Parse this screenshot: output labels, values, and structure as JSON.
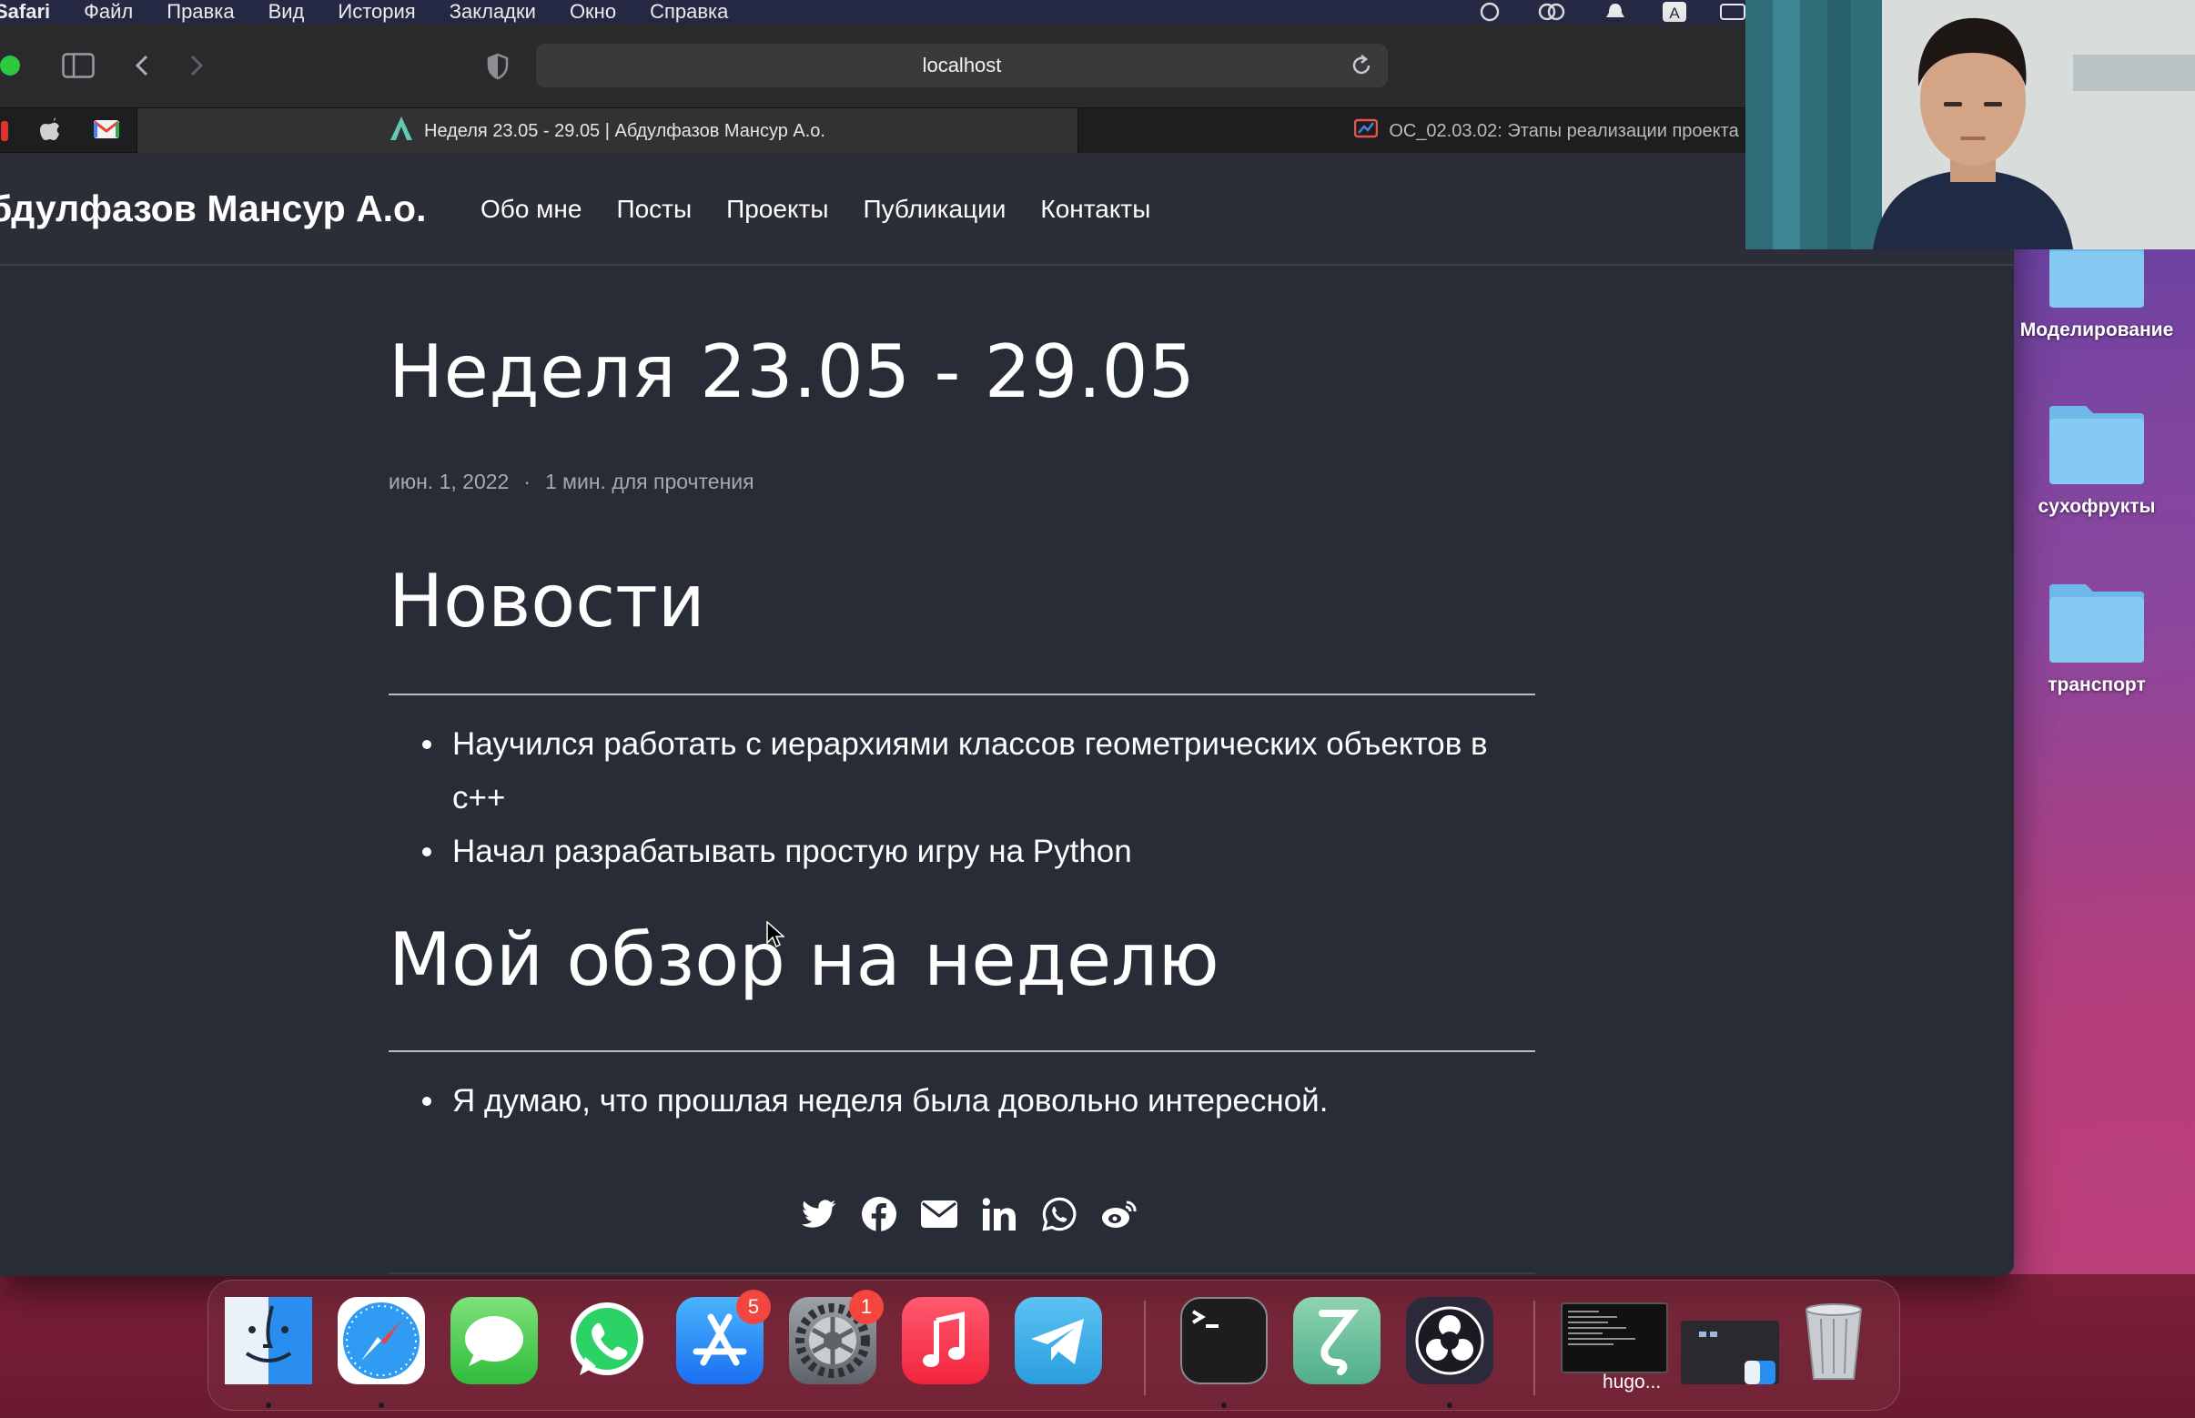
{
  "menubar": {
    "items": [
      "Safari",
      "Файл",
      "Правка",
      "Вид",
      "История",
      "Закладки",
      "Окно",
      "Справка"
    ]
  },
  "browser": {
    "address": "localhost",
    "tabs": [
      {
        "title": "Неделя 23.05 - 29.05 | Абдулфазов Мансур А.о.",
        "active": true
      },
      {
        "title": "ОС_02.03.02: Этапы реализации проекта",
        "active": false
      }
    ],
    "pinned_icons": [
      "apple-icon",
      "gmail-icon"
    ]
  },
  "site": {
    "title": "бдулфазов Мансур А.о.",
    "nav": [
      "Обо мне",
      "Посты",
      "Проекты",
      "Публикации",
      "Контакты"
    ]
  },
  "post": {
    "title": "Неделя 23.05 - 29.05",
    "date": "июн. 1, 2022",
    "separator": "·",
    "reading_time": "1 мин. для прочтения",
    "sections": [
      {
        "heading": "Новости",
        "items": [
          "Научился работать с иерархиями классов геометрических объектов в c++",
          "Начал разрабатывать простую игру на Python"
        ]
      },
      {
        "heading": "Мой обзор на неделю",
        "items": [
          "Я думаю, что прошлая неделя была довольно интересной."
        ]
      }
    ],
    "share_icons": [
      "twitter-icon",
      "facebook-icon",
      "email-icon",
      "linkedin-icon",
      "whatsapp-icon",
      "weibo-icon"
    ]
  },
  "desktop": {
    "folders": [
      "Моделирование",
      "сухофрукты",
      "транспорт"
    ]
  },
  "dock": {
    "apps": [
      {
        "name": "Finder",
        "badge": ""
      },
      {
        "name": "Safari",
        "badge": ""
      },
      {
        "name": "Messages",
        "badge": ""
      },
      {
        "name": "WhatsApp",
        "badge": ""
      },
      {
        "name": "App Store",
        "badge": "5"
      },
      {
        "name": "System Preferences",
        "badge": "1"
      },
      {
        "name": "Music",
        "badge": ""
      },
      {
        "name": "Telegram",
        "badge": ""
      },
      {
        "name": "Terminal",
        "badge": ""
      },
      {
        "name": "Scrivener",
        "badge": ""
      },
      {
        "name": "OBS",
        "badge": ""
      }
    ],
    "minimized_label": "hugo..."
  },
  "colors": {
    "page_bg": "#282c36",
    "header_bg": "#2b2e37",
    "text": "#ffffff",
    "meta": "#a7a9ae"
  }
}
